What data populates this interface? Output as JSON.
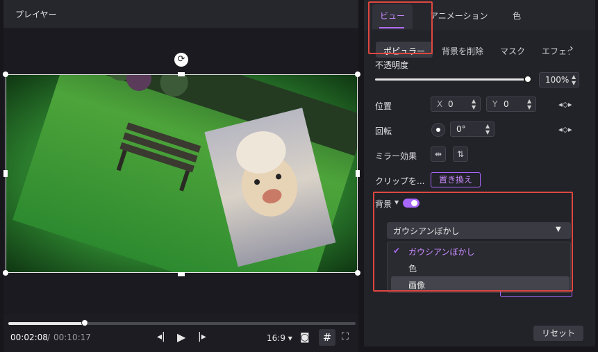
{
  "player": {
    "title": "プレイヤー",
    "time_current": "00:02:08",
    "time_separator": "/",
    "time_total": "00:10:17",
    "progress_fraction": 0.22,
    "aspect_label": "16:9",
    "aspect_caret": "▾"
  },
  "panel": {
    "tabs": [
      {
        "label": "ビュー",
        "active": true
      },
      {
        "label": "アニメーション",
        "active": false
      },
      {
        "label": "色",
        "active": false
      }
    ],
    "subtabs": [
      {
        "label": "ポピュラー",
        "active": true
      },
      {
        "label": "背景を削除",
        "active": false
      },
      {
        "label": "マスク",
        "active": false
      },
      {
        "label": "エフェク",
        "active": false
      }
    ],
    "opacity": {
      "label": "不透明度",
      "value": "100%",
      "fraction": 1.0
    },
    "position": {
      "label": "位置",
      "x_axis": "X",
      "x_value": "0",
      "y_axis": "Y",
      "y_value": "0"
    },
    "rotation": {
      "label": "回転",
      "value": "0°"
    },
    "mirror": {
      "label": "ミラー効果"
    },
    "clip": {
      "label": "クリップを...",
      "replace_button": "置き換え"
    },
    "background": {
      "label": "背景",
      "enabled": true,
      "dropdown_value": "ガウシアンぼかし",
      "options": [
        {
          "label": "ガウシアンぼかし",
          "selected": true
        },
        {
          "label": "色",
          "selected": false
        },
        {
          "label": "画像",
          "selected": false,
          "hovered": true
        }
      ]
    },
    "reset_button": "リセット"
  },
  "colors": {
    "accent": "#a867ff",
    "highlight_box": "#e0473f",
    "panel_bg": "#222229"
  }
}
